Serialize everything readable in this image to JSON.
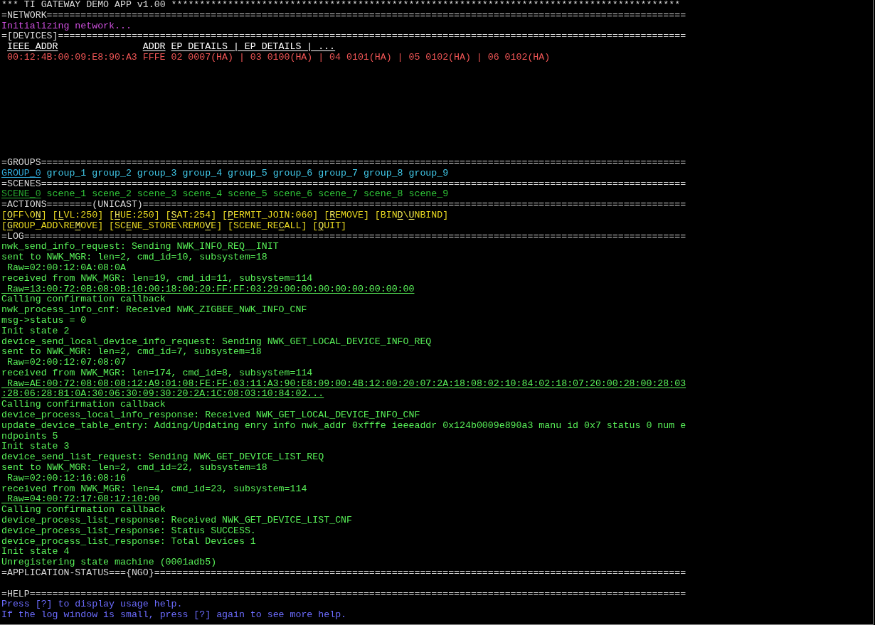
{
  "title": "*** TI GATEWAY DEMO APP v1.00 ******************************************************************************************",
  "network": {
    "header": "=NETWORK=================================================================================================================",
    "status": "Initializing network..."
  },
  "devices": {
    "header": "=[DEVICES]===============================================================================================================",
    "columns": [
      "IEEE_ADDR",
      "ADDR",
      "EP DETAILS | EP DETAILS | ..."
    ],
    "rows": [
      {
        "cells": [
          "00:12:4B:00:09:E8:90:A3",
          "FFFE",
          "02 0007(HA) | 03 0100(HA) | 04 0101(HA) | 05 0102(HA) | 06 0102(HA)"
        ]
      }
    ]
  },
  "groups": {
    "header": "=GROUPS==================================================================================================================",
    "items": [
      {
        "label": "GROUP_0",
        "selected": true
      },
      {
        "label": "group_1",
        "selected": false
      },
      {
        "label": "group_2",
        "selected": false
      },
      {
        "label": "group_3",
        "selected": false
      },
      {
        "label": "group_4",
        "selected": false
      },
      {
        "label": "group_5",
        "selected": false
      },
      {
        "label": "group_6",
        "selected": false
      },
      {
        "label": "group_7",
        "selected": false
      },
      {
        "label": "group_8",
        "selected": false
      },
      {
        "label": "group_9",
        "selected": false
      }
    ]
  },
  "scenes": {
    "header": "=SCENES==================================================================================================================",
    "items": [
      {
        "label": "SCENE_0",
        "selected": true
      },
      {
        "label": "scene_1",
        "selected": false
      },
      {
        "label": "scene_2",
        "selected": false
      },
      {
        "label": "scene_3",
        "selected": false
      },
      {
        "label": "scene_4",
        "selected": false
      },
      {
        "label": "scene_5",
        "selected": false
      },
      {
        "label": "scene_6",
        "selected": false
      },
      {
        "label": "scene_7",
        "selected": false
      },
      {
        "label": "scene_8",
        "selected": false
      },
      {
        "label": "scene_9",
        "selected": false
      }
    ]
  },
  "actions": {
    "header": "=ACTIONS========(UNICAST)================================================================================================",
    "lines": [
      {
        "keys": [
          {
            "segments": [
              {
                "text": "[",
                "hotkey": false
              },
              {
                "text": "O",
                "hotkey": true
              },
              {
                "text": "FF\\O",
                "hotkey": false
              },
              {
                "text": "N",
                "hotkey": true
              },
              {
                "text": "]",
                "hotkey": false
              }
            ]
          },
          {
            "segments": [
              {
                "text": "[",
                "hotkey": false
              },
              {
                "text": "L",
                "hotkey": true
              },
              {
                "text": "VL:250]",
                "hotkey": false
              }
            ]
          },
          {
            "segments": [
              {
                "text": "[",
                "hotkey": false
              },
              {
                "text": "H",
                "hotkey": true
              },
              {
                "text": "UE:250]",
                "hotkey": false
              }
            ]
          },
          {
            "segments": [
              {
                "text": "[",
                "hotkey": false
              },
              {
                "text": "S",
                "hotkey": true
              },
              {
                "text": "AT:254]",
                "hotkey": false
              }
            ]
          },
          {
            "segments": [
              {
                "text": "[",
                "hotkey": false
              },
              {
                "text": "P",
                "hotkey": true
              },
              {
                "text": "ERMIT_JOIN:060]",
                "hotkey": false
              }
            ]
          },
          {
            "segments": [
              {
                "text": "[",
                "hotkey": false
              },
              {
                "text": "R",
                "hotkey": true
              },
              {
                "text": "EMOVE]",
                "hotkey": false
              }
            ]
          },
          {
            "segments": [
              {
                "text": "[BIN",
                "hotkey": false
              },
              {
                "text": "D",
                "hotkey": true
              },
              {
                "text": "\\",
                "hotkey": false
              },
              {
                "text": "U",
                "hotkey": true
              },
              {
                "text": "NBIND]",
                "hotkey": false
              }
            ]
          }
        ]
      },
      {
        "keys": [
          {
            "segments": [
              {
                "text": "[",
                "hotkey": false
              },
              {
                "text": "G",
                "hotkey": true
              },
              {
                "text": "ROUP_ADD\\RE",
                "hotkey": false
              },
              {
                "text": "M",
                "hotkey": true
              },
              {
                "text": "OVE]",
                "hotkey": false
              }
            ]
          },
          {
            "segments": [
              {
                "text": "[SC",
                "hotkey": false
              },
              {
                "text": "E",
                "hotkey": true
              },
              {
                "text": "NE_STORE\\REMO",
                "hotkey": false
              },
              {
                "text": "V",
                "hotkey": true
              },
              {
                "text": "E]",
                "hotkey": false
              }
            ]
          },
          {
            "segments": [
              {
                "text": "[SCENE_RE",
                "hotkey": false
              },
              {
                "text": "C",
                "hotkey": true
              },
              {
                "text": "ALL]",
                "hotkey": false
              }
            ]
          },
          {
            "segments": [
              {
                "text": "[",
                "hotkey": false
              },
              {
                "text": "Q",
                "hotkey": true
              },
              {
                "text": "UIT]",
                "hotkey": false
              }
            ]
          }
        ]
      }
    ]
  },
  "log": {
    "header": "=LOG=====================================================================================================================",
    "lines": [
      {
        "text": "nwk_send_info_request: Sending NWK_INFO_REQ__INIT",
        "underlined": false
      },
      {
        "text": "sent to NWK_MGR: len=2, cmd_id=10, subsystem=18",
        "underlined": false
      },
      {
        "text": " Raw=02:00:12:0A:08:0A",
        "underlined": false
      },
      {
        "text": "received from NWK_MGR: len=19, cmd_id=11, subsystem=114",
        "underlined": false
      },
      {
        "text": " Raw=13:00:72:0B:08:0B:10:00:18:00:20:FF:FF:03:29:00:00:00:00:00:00:00:00",
        "underlined": true
      },
      {
        "text": "Calling confirmation callback",
        "underlined": false
      },
      {
        "text": "nwk_process_info_cnf: Received NWK_ZIGBEE_NWK_INFO_CNF",
        "underlined": false
      },
      {
        "text": "msg->status = 0",
        "underlined": false
      },
      {
        "text": "Init state 2",
        "underlined": false
      },
      {
        "text": "device_send_local_device_info_request: Sending NWK_GET_LOCAL_DEVICE_INFO_REQ",
        "underlined": false
      },
      {
        "text": "sent to NWK_MGR: len=2, cmd_id=7, subsystem=18",
        "underlined": false
      },
      {
        "text": " Raw=02:00:12:07:08:07",
        "underlined": false
      },
      {
        "text": "received from NWK_MGR: len=174, cmd_id=8, subsystem=114",
        "underlined": false
      },
      {
        "text": " Raw=AE:00:72:08:08:08:12:A9:01:08:FE:FF:03:11:A3:90:E8:09:00:4B:12:00:20:07:2A:18:08:02:10:84:02:18:07:20:00:28:00:28:03",
        "underlined": true
      },
      {
        "text": ":28:06:28:81:0A:30:06:30:09:30:20:2A:1C:08:03:10:84:02...",
        "underlined": true
      },
      {
        "text": "Calling confirmation callback",
        "underlined": false
      },
      {
        "text": "device_process_local_info_response: Received NWK_GET_LOCAL_DEVICE_INFO_CNF",
        "underlined": false
      },
      {
        "text": "update_device_table_entry: Adding/Updating enry info nwk_addr 0xfffe ieeeaddr 0x124b0009e890a3 manu id 0x7 status 0 num e",
        "underlined": false
      },
      {
        "text": "ndpoints 5",
        "underlined": false
      },
      {
        "text": "Init state 3",
        "underlined": false
      },
      {
        "text": "device_send_list_request: Sending NWK_GET_DEVICE_LIST_REQ",
        "underlined": false
      },
      {
        "text": "sent to NWK_MGR: len=2, cmd_id=22, subsystem=18",
        "underlined": false
      },
      {
        "text": " Raw=02:00:12:16:08:16",
        "underlined": false
      },
      {
        "text": "received from NWK_MGR: len=4, cmd_id=23, subsystem=114",
        "underlined": false
      },
      {
        "text": " Raw=04:00:72:17:08:17:10:00",
        "underlined": true
      },
      {
        "text": "Calling confirmation callback",
        "underlined": false
      },
      {
        "text": "device_process_list_response: Received NWK_GET_DEVICE_LIST_CNF",
        "underlined": false
      },
      {
        "text": "device_process_list_response: Status SUCCESS.",
        "underlined": false
      },
      {
        "text": "device_process_list_response: Total Devices 1",
        "underlined": false
      },
      {
        "text": "Init state 4",
        "underlined": false
      },
      {
        "text": "Unregistering state machine (0001adb5)",
        "underlined": false
      }
    ]
  },
  "application_status": {
    "header": "=APPLICATION-STATUS==={NGO}=============================================================================================="
  },
  "help": {
    "header": "=HELP====================================================================================================================",
    "lines": [
      "Press [?] to display usage help.",
      "If the log window is small, press [?] again to see more help."
    ]
  }
}
